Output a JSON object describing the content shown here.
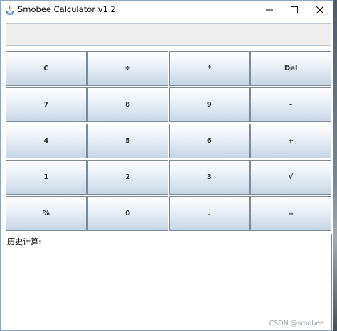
{
  "window": {
    "title": "Smobee Calculator v1.2"
  },
  "display": {
    "value": ""
  },
  "keypad": {
    "keys": [
      [
        "C",
        "÷",
        "*",
        "Del"
      ],
      [
        "7",
        "8",
        "9",
        "-"
      ],
      [
        "4",
        "5",
        "6",
        "+"
      ],
      [
        "1",
        "2",
        "3",
        "√"
      ],
      [
        "%",
        "0",
        ".",
        "="
      ]
    ]
  },
  "history": {
    "label": "历史计算:"
  },
  "watermark": {
    "text": "CSDN @smobee"
  },
  "colors": {
    "key_gradient_top": "#ffffff",
    "key_gradient_bottom": "#c6d5e4",
    "display_bg": "#eeeeee"
  }
}
